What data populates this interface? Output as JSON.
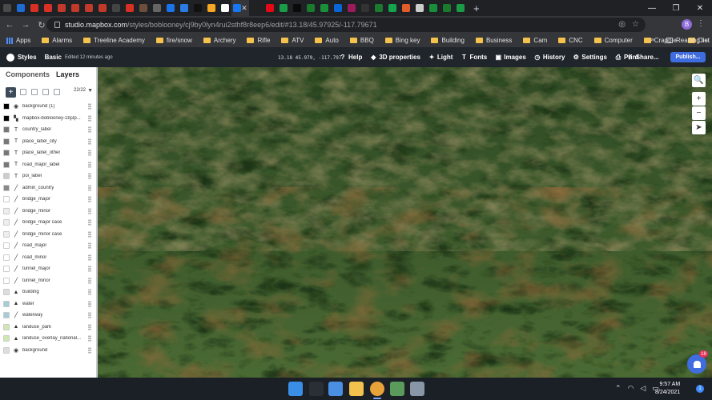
{
  "browser": {
    "tab_favicon_colors": [
      "#4a4a4a",
      "#1e6bd6",
      "#d93025",
      "#d93025",
      "#c0392b",
      "#c0392b",
      "#c0392b",
      "#c0392b",
      "#444444",
      "#d93025",
      "#6b4f3a",
      "#666666",
      "#1a73e8",
      "#2c7be5",
      "#111111",
      "#f5a623",
      "#ffffff",
      "#1877f2",
      "#222222",
      "#e50914",
      "#1a9b46",
      "#0a0a0a",
      "#1a7a2e",
      "#1a8f3a",
      "#0b64d6",
      "#9b1b5a",
      "#333333",
      "#1a7a2e",
      "#14a44d",
      "#e25d2b",
      "#cccccc",
      "#1a8f3a",
      "#1a7a2e",
      "#1a9b46"
    ],
    "new_tab_label": "+",
    "window_controls": {
      "minimize": "—",
      "maximize": "❐",
      "close": "✕"
    },
    "url_host": "studio.mapbox.com",
    "url_path": "/styles/boblooney/cj9by0lyn4rui2sthf8r8eep6/edit/#13.18/45.97925/-117.79671",
    "profile_initial": "B",
    "bookmarks": [
      {
        "label": "Apps",
        "icon": "apps-grid-icon"
      },
      {
        "label": "Alarms",
        "icon": "folder-icon"
      },
      {
        "label": "Treeline Academy",
        "icon": "folder-icon"
      },
      {
        "label": "fire/snow",
        "icon": "folder-icon"
      },
      {
        "label": "Archery",
        "icon": "folder-icon"
      },
      {
        "label": "Rifle",
        "icon": "folder-icon"
      },
      {
        "label": "ATV",
        "icon": "folder-icon"
      },
      {
        "label": "Auto",
        "icon": "folder-icon"
      },
      {
        "label": "BBQ",
        "icon": "folder-icon"
      },
      {
        "label": "Bing key",
        "icon": "folder-icon"
      },
      {
        "label": "Building",
        "icon": "folder-icon"
      },
      {
        "label": "Business",
        "icon": "folder-icon"
      },
      {
        "label": "Cam",
        "icon": "folder-icon"
      },
      {
        "label": "CNC",
        "icon": "folder-icon"
      },
      {
        "label": "Computer",
        "icon": "folder-icon"
      },
      {
        "label": "Crappie",
        "icon": "folder-icon"
      },
      {
        "label": "Diet",
        "icon": "folder-icon"
      }
    ],
    "bookmarks_overflow": "»",
    "reading_list": "Reading list"
  },
  "mapbox": {
    "section": "Styles",
    "style_name": "Basic",
    "edited": "Edited 12 minutes ago",
    "coords": "13.18  45.979, -117.797",
    "actions": [
      {
        "label": "Help",
        "icon": "help-icon",
        "glyph": "?"
      },
      {
        "label": "3D properties",
        "icon": "3d-icon",
        "glyph": "◆"
      },
      {
        "label": "Light",
        "icon": "light-icon",
        "glyph": "✦"
      },
      {
        "label": "Fonts",
        "icon": "fonts-icon",
        "glyph": "T"
      },
      {
        "label": "Images",
        "icon": "images-icon",
        "glyph": "▣"
      },
      {
        "label": "History",
        "icon": "history-icon",
        "glyph": "◷"
      },
      {
        "label": "Settings",
        "icon": "settings-icon",
        "glyph": "⚙"
      },
      {
        "label": "Print",
        "icon": "print-icon",
        "glyph": "⎙"
      }
    ],
    "share": "Share...",
    "publish": "Publish...",
    "accent": "#3f6cde"
  },
  "panel": {
    "tabs": [
      "Components",
      "Layers"
    ],
    "add": "+",
    "layer_count": "22/22",
    "layers": [
      {
        "name": "background (1)",
        "color": "#000000",
        "type": "globe"
      },
      {
        "name": "mapbox-boblooney-1bj3p...",
        "color": "#000000",
        "type": "raster"
      },
      {
        "name": "country_label",
        "color": "#777777",
        "type": "symbol"
      },
      {
        "name": "place_label_city",
        "color": "#777777",
        "type": "symbol"
      },
      {
        "name": "place_label_other",
        "color": "#777777",
        "type": "symbol"
      },
      {
        "name": "road_major_label",
        "color": "#777777",
        "type": "symbol"
      },
      {
        "name": "poi_label",
        "color": "#cccccc",
        "type": "symbol"
      },
      {
        "name": "admin_country",
        "color": "#888888",
        "type": "line"
      },
      {
        "name": "bridge_major",
        "color": "#ffffff",
        "type": "line"
      },
      {
        "name": "bridge_minor",
        "color": "#eeeeee",
        "type": "line"
      },
      {
        "name": "bridge_major case",
        "color": "#eeeeee",
        "type": "line"
      },
      {
        "name": "bridge_minor case",
        "color": "#eeeeee",
        "type": "line"
      },
      {
        "name": "road_major",
        "color": "#ffffff",
        "type": "line"
      },
      {
        "name": "road_minor",
        "color": "#ffffff",
        "type": "line"
      },
      {
        "name": "tunnel_major",
        "color": "#ffffff",
        "type": "line"
      },
      {
        "name": "tunnel_minor",
        "color": "#ffffff",
        "type": "line"
      },
      {
        "name": "building",
        "color": "#dddddd",
        "type": "fill"
      },
      {
        "name": "water",
        "color": "#a8ccd7",
        "type": "fill"
      },
      {
        "name": "waterway",
        "color": "#a8ccd7",
        "type": "line"
      },
      {
        "name": "landuse_park",
        "color": "#cfe8b3",
        "type": "fill"
      },
      {
        "name": "landuse_overlay_national...",
        "color": "#cfe8b3",
        "type": "fill"
      },
      {
        "name": "background",
        "color": "#dddddd",
        "type": "globe"
      }
    ]
  },
  "map_controls": [
    "🔍",
    "+",
    "−",
    "➤"
  ],
  "notification_count": "18",
  "taskbar": {
    "apps": [
      {
        "name": "start-icon",
        "color": "#3a8ee6"
      },
      {
        "name": "search-icon",
        "color": "#2a2f36"
      },
      {
        "name": "widgets-icon",
        "color": "#4a90e2"
      },
      {
        "name": "file-explorer-icon",
        "color": "#f2c14e"
      },
      {
        "name": "chrome-icon",
        "color": "#e8a23a"
      },
      {
        "name": "map-app-icon",
        "color": "#5a9a5a"
      },
      {
        "name": "network-app-icon",
        "color": "#8896a8"
      }
    ],
    "time": "9:57 AM",
    "date": "8/24/2021",
    "badge": "1"
  }
}
